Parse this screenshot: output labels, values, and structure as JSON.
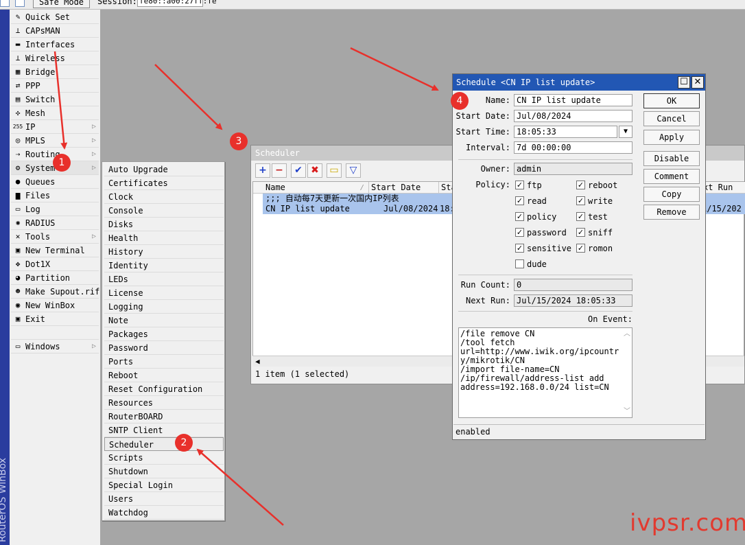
{
  "topbar": {
    "safe_mode": "Safe Mode",
    "session_label": "Session:",
    "session_value": "fe80::a00:27ff:fe"
  },
  "brand": {
    "text": "RouterOS WinBox"
  },
  "main_menu": [
    {
      "label": "Quick Set",
      "icon": "wand-icon",
      "glyph": "✎",
      "submenu": false
    },
    {
      "label": "CAPsMAN",
      "icon": "antenna-icon",
      "glyph": "⊥",
      "submenu": false
    },
    {
      "label": "Interfaces",
      "icon": "interfaces-icon",
      "glyph": "▬",
      "submenu": false
    },
    {
      "label": "Wireless",
      "icon": "wireless-icon",
      "glyph": "⊥",
      "submenu": false
    },
    {
      "label": "Bridge",
      "icon": "bridge-icon",
      "glyph": "▦",
      "submenu": false
    },
    {
      "label": "PPP",
      "icon": "ppp-icon",
      "glyph": "⇄",
      "submenu": false
    },
    {
      "label": "Switch",
      "icon": "switch-icon",
      "glyph": "▤",
      "submenu": false
    },
    {
      "label": "Mesh",
      "icon": "mesh-icon",
      "glyph": "✣",
      "submenu": false
    },
    {
      "label": "IP",
      "icon": "ip-icon",
      "glyph": "255",
      "submenu": true
    },
    {
      "label": "MPLS",
      "icon": "mpls-icon",
      "glyph": "◎",
      "submenu": true
    },
    {
      "label": "Routing",
      "icon": "routing-icon",
      "glyph": "⇢",
      "submenu": true
    },
    {
      "label": "System",
      "icon": "gear-icon",
      "glyph": "⚙",
      "submenu": true
    },
    {
      "label": "Queues",
      "icon": "queues-icon",
      "glyph": "●",
      "submenu": false
    },
    {
      "label": "Files",
      "icon": "folder-icon",
      "glyph": "▆",
      "submenu": false
    },
    {
      "label": "Log",
      "icon": "log-icon",
      "glyph": "▭",
      "submenu": false
    },
    {
      "label": "RADIUS",
      "icon": "radius-icon",
      "glyph": "✺",
      "submenu": false
    },
    {
      "label": "Tools",
      "icon": "tools-icon",
      "glyph": "✕",
      "submenu": true
    },
    {
      "label": "New Terminal",
      "icon": "terminal-icon",
      "glyph": "▣",
      "submenu": false
    },
    {
      "label": "Dot1X",
      "icon": "dot1x-icon",
      "glyph": "✥",
      "submenu": false
    },
    {
      "label": "Partition",
      "icon": "partition-icon",
      "glyph": "◕",
      "submenu": false
    },
    {
      "label": "Make Supout.rif",
      "icon": "supout-icon",
      "glyph": "☻",
      "submenu": false
    },
    {
      "label": "New WinBox",
      "icon": "winbox-icon",
      "glyph": "◉",
      "submenu": false
    },
    {
      "label": "Exit",
      "icon": "exit-icon",
      "glyph": "▣",
      "submenu": false
    },
    {
      "label": "",
      "icon": "",
      "glyph": "",
      "submenu": false
    },
    {
      "label": "Windows",
      "icon": "windows-icon",
      "glyph": "▭",
      "submenu": true
    }
  ],
  "system_submenu": [
    "Auto Upgrade",
    "Certificates",
    "Clock",
    "Console",
    "Disks",
    "Health",
    "History",
    "Identity",
    "LEDs",
    "License",
    "Logging",
    "Note",
    "Packages",
    "Password",
    "Ports",
    "Reboot",
    "Reset Configuration",
    "Resources",
    "RouterBOARD",
    "SNTP Client",
    "Scheduler",
    "Scripts",
    "Shutdown",
    "Special Login",
    "Users",
    "Watchdog"
  ],
  "scheduler_window": {
    "title": "Scheduler",
    "columns": [
      "Name",
      "Start Date",
      "Sta",
      "xt Run"
    ],
    "rows": [
      {
        "name": ";;; 自动每7天更新一次国内IP列表",
        "start_date": "",
        "start_time": "",
        "next_run": ""
      },
      {
        "name": "CN IP list update",
        "start_date": "Jul/08/2024",
        "start_time": "18:",
        "next_run": "1/15/202"
      }
    ],
    "status": "1 item (1 selected)",
    "toolbar": {
      "add": "+",
      "remove": "−",
      "enable": "✔",
      "disable": "✖",
      "comment": "▭",
      "filter": "▽"
    }
  },
  "schedule_dialog": {
    "title": "Schedule <CN IP list update>",
    "fields": {
      "name_label": "Name:",
      "name": "CN IP list update",
      "start_date_label": "Start Date:",
      "start_date": "Jul/08/2024",
      "start_time_label": "Start Time:",
      "start_time": "18:05:33",
      "interval_label": "Interval:",
      "interval": "7d 00:00:00",
      "owner_label": "Owner:",
      "owner": "admin",
      "policy_label": "Policy:",
      "run_count_label": "Run Count:",
      "run_count": "0",
      "next_run_label": "Next Run:",
      "next_run": "Jul/15/2024 18:05:33",
      "on_event_label": "On Event:"
    },
    "policies": [
      {
        "label": "ftp",
        "checked": true
      },
      {
        "label": "reboot",
        "checked": true
      },
      {
        "label": "read",
        "checked": true
      },
      {
        "label": "write",
        "checked": true
      },
      {
        "label": "policy",
        "checked": true
      },
      {
        "label": "test",
        "checked": true
      },
      {
        "label": "password",
        "checked": true
      },
      {
        "label": "sniff",
        "checked": true
      },
      {
        "label": "sensitive",
        "checked": true
      },
      {
        "label": "romon",
        "checked": true
      },
      {
        "label": "dude",
        "checked": false
      }
    ],
    "on_event_lines": [
      "/file remove CN",
      "/tool fetch",
      "url=http://www.iwik.org/ipcountr",
      "y/mikrotik/CN",
      "/import file-name=CN",
      "/ip/firewall/address-list add",
      "address=192.168.0.0/24 list=CN"
    ],
    "buttons": {
      "ok": "OK",
      "cancel": "Cancel",
      "apply": "Apply",
      "disable": "Disable",
      "comment": "Comment",
      "copy": "Copy",
      "remove": "Remove"
    },
    "status": "enabled"
  },
  "annotations": {
    "badges": [
      "1",
      "2",
      "3",
      "4"
    ],
    "color": "#e8302b"
  },
  "watermark": "ivpsr.com",
  "colors": {
    "title_active": "#2257b4",
    "selection": "#a9c4ec",
    "brand_bar": "#2a3c9e"
  }
}
